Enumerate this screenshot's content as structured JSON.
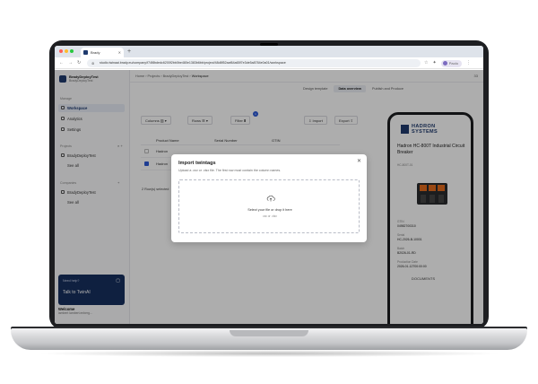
{
  "browser": {
    "tab_title": "Brady",
    "url": "studio.twinaai.brady.eu/company/f74f8bdedc6200f2bb0be480e1383b6bb/project/48d8f52aaf64a65f7e3de5a8784e0a01/workspace",
    "profile_name": "Paolo"
  },
  "sidebar": {
    "org_name": "BradyDeployTest",
    "org_sub": "BradyDeployTest",
    "section_manage": "Manage",
    "nav": [
      "Workspace",
      "Analytics",
      "Settings"
    ],
    "section_projects": "Projects",
    "project_item": "BradyDeployTest",
    "projects_see_all": "See all",
    "section_companies": "Companies",
    "company_item": "BradyDeployTest",
    "companies_see_all": "See all",
    "help_label": "Need help?",
    "help_cta": "Talk to TwinAI",
    "user_title": "Welcome",
    "user_sub": "lambert lambert.enberg..."
  },
  "topbar": {
    "crumbs": [
      "Home",
      "Projects",
      "BradyDeployTest",
      "Workspace"
    ],
    "right": "33"
  },
  "subtabs": [
    "Design template",
    "Data overview",
    "Publish and Produce"
  ],
  "toolbar": {
    "columns": "Columns",
    "rows": "Rows",
    "filter": "Filter",
    "filter_count": "1",
    "import": "Import",
    "export": "Export"
  },
  "table": {
    "headers": [
      "Product Name",
      "Serial Number",
      "GTIN"
    ],
    "rows": [
      {
        "product": "Hadron"
      },
      {
        "product": "Hadron"
      }
    ],
    "rows_selected": "2 Row(s) selected"
  },
  "phone": {
    "brand_line1": "HADRON",
    "brand_line2": "SYSTEMS",
    "product_title": "Hadron HC-800T Industrial Circuit Breaker",
    "product_sub": "HC-800T-01",
    "gtin_label": "GTIN",
    "gtin_value": "04982700310",
    "serial_label": "Serial",
    "serial_value": "HC-2026-B-10001",
    "batch_label": "Batch",
    "batch_value": "B2026-01-RD",
    "date_label": "Production Date",
    "date_value": "2026-01-12T00:00:00",
    "documents": "DOCUMENTS"
  },
  "modal": {
    "title": "Import twintags",
    "description": "Upload a .csv or .xlsx file. The first row must contain the column names.",
    "drop_text": "Select your file or drop it here",
    "drop_formats": "csv or .xlsx"
  },
  "colors": {
    "brand": "#1f3a6e",
    "accent": "#2d5bd8"
  }
}
